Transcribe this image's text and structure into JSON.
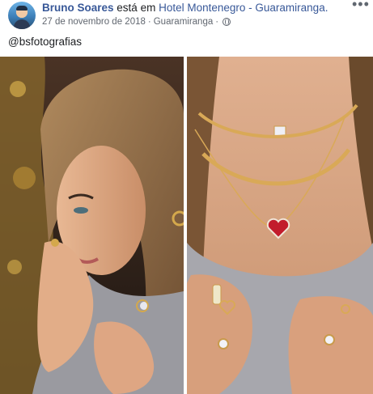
{
  "post": {
    "author": "Bruno Soares",
    "verb": "está em",
    "location": "Hotel Montenegro - Guaramiranga.",
    "date": "27 de novembro de 2018",
    "separator": "·",
    "place": "Guaramiranga",
    "privacy_icon": "globe-icon",
    "more_icon": "more-options-icon",
    "more_label": "•••",
    "caption": "@bsfotografias"
  },
  "colors": {
    "link": "#385898",
    "meta": "#616770",
    "text": "#1c1e21"
  }
}
